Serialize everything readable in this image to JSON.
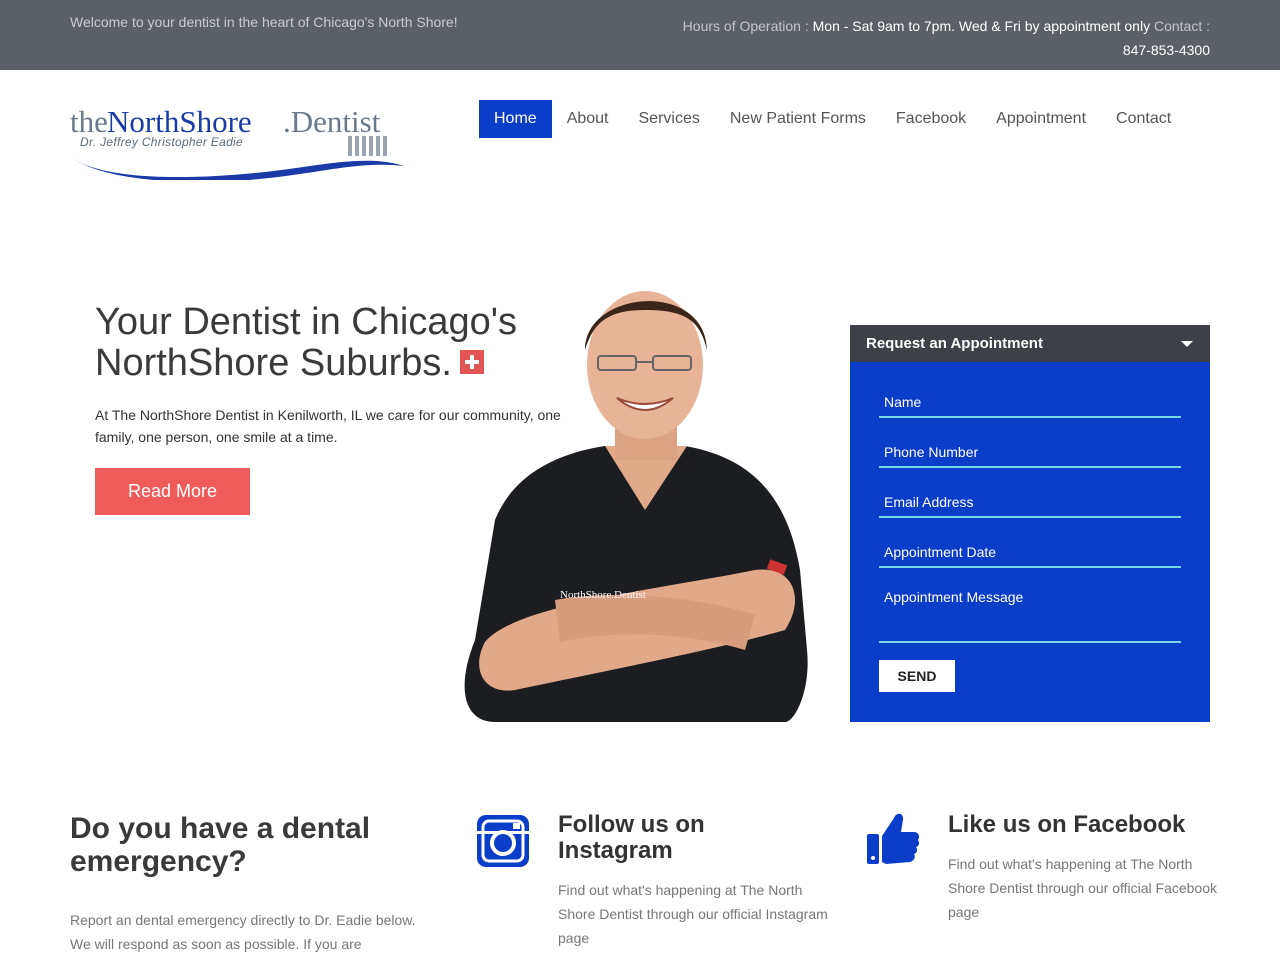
{
  "topbar": {
    "welcome": "Welcome to your dentist in the heart of Chicago's North Shore!",
    "hours_label": "Hours of Operation :",
    "hours_value": "Mon - Sat 9am to 7pm. Wed & Fri by appointment only",
    "contact_label": "Contact :",
    "phone": "847-853-4300"
  },
  "logo": {
    "the": "the",
    "northshore": "NorthShore",
    "dentist": ".Dentist",
    "subtitle": "Dr. Jeffrey Christopher Eadie"
  },
  "nav": {
    "items": [
      {
        "label": "Home"
      },
      {
        "label": "About"
      },
      {
        "label": "Services"
      },
      {
        "label": "New Patient Forms"
      },
      {
        "label": "Facebook"
      },
      {
        "label": "Appointment"
      },
      {
        "label": "Contact"
      }
    ]
  },
  "hero": {
    "title": "Your Dentist in Chicago's NorthShore Suburbs.",
    "text": "At The NorthShore Dentist in Kenilworth, IL we care for our community, one family, one person, one smile at a time.",
    "read_more": "Read More",
    "cross_icon": "medical-cross-icon",
    "shirt_logo": "NorthShore.Dentist"
  },
  "form": {
    "title": "Request an Appointment",
    "name_placeholder": "Name",
    "phone_placeholder": "Phone Number",
    "email_placeholder": "Email Address",
    "date_placeholder": "Appointment Date",
    "message_placeholder": "Appointment Message",
    "send": "SEND"
  },
  "emergency": {
    "title": "Do you have a dental emergency?",
    "text": "Report an dental emergency directly to Dr. Eadie below. We will respond as soon as possible. If you are"
  },
  "instagram": {
    "icon": "instagram-icon",
    "title": "Follow us on Instagram",
    "text": "Find out what's happening at The North Shore Dentist through our official Instagram page"
  },
  "facebook": {
    "icon": "thumbs-up-icon",
    "title": "Like us on Facebook",
    "text": "Find out what's happening at The North Shore Dentist through our official Facebook page"
  },
  "colors": {
    "brand_blue": "#0a3dc8",
    "accent_red": "#ef5b5b",
    "topbar_gray": "#5b5f66"
  }
}
